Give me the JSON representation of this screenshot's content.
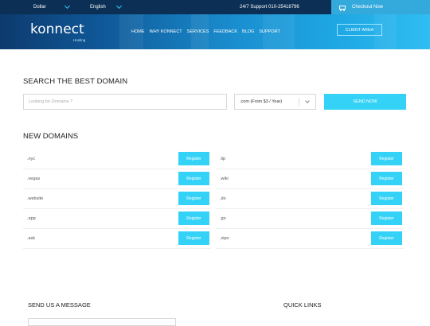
{
  "topbar": {
    "currency": "Dollar",
    "language": "English",
    "support": "24/7 Support 010-25418796",
    "checkout": "Checkout Now"
  },
  "header": {
    "logo": "konnect",
    "logo_sub": "Hosting",
    "nav": [
      "HOME",
      "WHY KONNECT",
      "SERVICES",
      "FEEDBACK",
      "BLOG",
      "SUPPORT"
    ],
    "client_area": "CLIENT AREA"
  },
  "search": {
    "title": "SEARCH THE BEST DOMAIN",
    "placeholder": "Looking for Domains ?",
    "select_value": ".com (From $3 / Year)",
    "button": "SEND NOW"
  },
  "new_domains": {
    "title": "NEW DOMAINS",
    "left": [
      ".nyc",
      ".vegas",
      ".website",
      ".app",
      ".ask"
    ],
    "right": [
      ".lip",
      ".wiki",
      ".do",
      ".go",
      ".zipo"
    ],
    "register_label": "Register"
  },
  "footer": {
    "message_title": "SEND US A MESSAGE",
    "links_title": "QUICK LINKS"
  },
  "colors": {
    "accent": "#35d2f7",
    "topbar": "#0c2f55",
    "checkout": "#34a9dc"
  }
}
